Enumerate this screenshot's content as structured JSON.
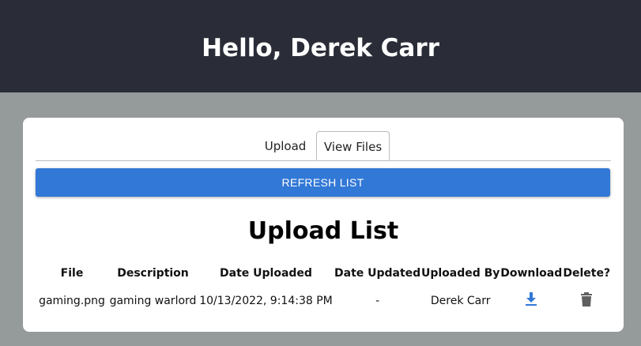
{
  "header": {
    "greeting": "Hello, Derek Carr"
  },
  "tabs": [
    {
      "label": "Upload",
      "active": false
    },
    {
      "label": "View Files",
      "active": true
    }
  ],
  "refresh_label": "REFRESH LIST",
  "list_title": "Upload List",
  "table": {
    "columns": [
      "File",
      "Description",
      "Date Uploaded",
      "Date Updated",
      "Uploaded By",
      "Download",
      "Delete?"
    ],
    "rows": [
      {
        "file": "gaming.png",
        "description": "gaming warlord",
        "date_uploaded": "10/13/2022, 9:14:38 PM",
        "date_updated": "-",
        "uploaded_by": "Derek Carr",
        "download_icon": "download-icon",
        "delete_icon": "trash-icon"
      }
    ]
  },
  "colors": {
    "header_bg": "#2a2d37",
    "page_bg": "#959a9b",
    "button_blue": "#3278d6",
    "download_icon": "#3278d6",
    "delete_icon": "#5f5f5f"
  }
}
